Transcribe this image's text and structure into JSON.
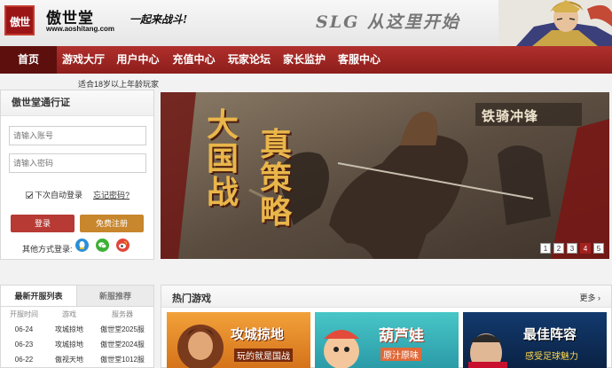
{
  "header": {
    "logo_glyph": "傲世",
    "site_name": "傲世堂",
    "site_url": "www.aoshitang.com",
    "slogan": "一起来战斗!",
    "banner_text": "SLG 从这里开始"
  },
  "nav": {
    "items": [
      {
        "label": "首页",
        "active": true
      },
      {
        "label": "游戏大厅",
        "active": false
      },
      {
        "label": "用户中心",
        "active": false
      },
      {
        "label": "充值中心",
        "active": false
      },
      {
        "label": "玩家论坛",
        "active": false
      },
      {
        "label": "家长监护",
        "active": false
      },
      {
        "label": "客服中心",
        "active": false
      }
    ],
    "age_tip": "适合18岁以上年龄玩家"
  },
  "login": {
    "title": "傲世堂通行证",
    "account_placeholder": "请输入账号",
    "password_placeholder": "请输入密码",
    "auto_login": "下次自动登录",
    "forgot": "忘记密码?",
    "login_btn": "登录",
    "register_btn": "免费注册",
    "other_login": "其他方式登录:"
  },
  "banner": {
    "headline_left": "大国战",
    "headline_right": "真策略",
    "game_logo": "铁骑冲锋",
    "pages": [
      "1",
      "2",
      "3",
      "4",
      "5"
    ],
    "active_page": 3
  },
  "servers": {
    "tabs": [
      "最新开服列表",
      "新服推荐"
    ],
    "columns": [
      "开服时间",
      "游戏",
      "服务器"
    ],
    "rows": [
      {
        "date": "06-24",
        "game": "攻城掠地",
        "server": "傲世堂2025服"
      },
      {
        "date": "06-23",
        "game": "攻城掠地",
        "server": "傲世堂2024服"
      },
      {
        "date": "06-22",
        "game": "傲视天地",
        "server": "傲世堂1012服"
      }
    ]
  },
  "hot_games": {
    "title": "热门游戏",
    "more": "更多",
    "cards": [
      {
        "name": "攻城掠地",
        "tagline": "玩的就是国战"
      },
      {
        "name": "葫芦娃",
        "tagline": "原汁原味"
      },
      {
        "name": "最佳阵容",
        "tagline": "感受足球魅力"
      }
    ]
  },
  "colors": {
    "brand_red": "#9b1416",
    "nav_red": "#a3221f",
    "nav_active": "#5d0f0e",
    "register_orange": "#c8862d"
  }
}
